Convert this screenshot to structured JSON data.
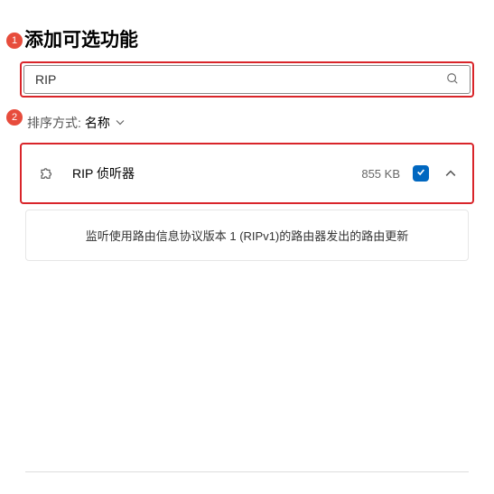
{
  "annotations": {
    "badge1": "1",
    "badge2": "2"
  },
  "title": "添加可选功能",
  "search": {
    "value": "RIP",
    "placeholder": ""
  },
  "sort": {
    "label": "排序方式:",
    "value": "名称"
  },
  "feature": {
    "name": "RIP 侦听器",
    "size": "855 KB",
    "checked": true,
    "expanded": true
  },
  "description": "监听使用路由信息协议版本 1 (RIPv1)的路由器发出的路由更新"
}
